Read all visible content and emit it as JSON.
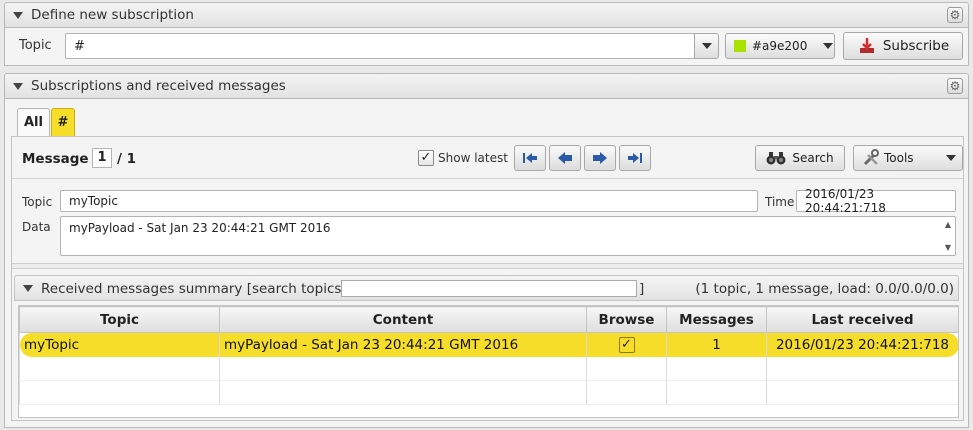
{
  "define_pane": {
    "title": "Define new subscription",
    "topic_label": "Topic",
    "topic_value": "#",
    "color_value": "#a9e200",
    "color_swatch": "#a9e200",
    "subscribe_label": "Subscribe"
  },
  "subs_pane": {
    "title": "Subscriptions and received messages",
    "tabs": [
      {
        "label": "All"
      },
      {
        "label": "#"
      }
    ],
    "message_label": "Message",
    "message_index": "1",
    "message_total": "/ 1",
    "show_latest_label": "Show latest",
    "show_latest_checked": "✓",
    "search_label": "Search",
    "tools_label": "Tools",
    "detail": {
      "topic_label": "Topic",
      "topic_value": "myTopic",
      "time_label": "Time",
      "time_value": "2016/01/23 20:44:21:718",
      "data_label": "Data",
      "data_value": "myPayload - Sat Jan 23 20:44:21 GMT 2016"
    }
  },
  "summary": {
    "title": "Received messages summary [search topics:",
    "title_close": "]",
    "search_value": "",
    "stats": "(1 topic, 1 message, load: 0.0/0.0/0.0)",
    "columns": [
      "Topic",
      "Content",
      "Browse",
      "Messages",
      "Last received"
    ],
    "rows": [
      {
        "topic": "myTopic",
        "content": "myPayload - Sat Jan 23 20:44:21 GMT 2016",
        "browse": "✓",
        "messages": "1",
        "last_received": "2016/01/23 20:44:21:718"
      }
    ]
  },
  "colors": {
    "selection": "#f5dd2a",
    "tab_active_bg": "#f5dd2a",
    "nav_arrow": "#2b5aa8"
  }
}
